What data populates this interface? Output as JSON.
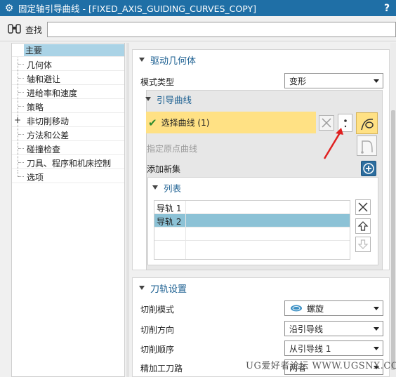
{
  "window": {
    "title": "固定轴引导曲线 - [FIXED_AXIS_GUIDING_CURVES_COPY]",
    "help_label": "?"
  },
  "search": {
    "label": "查找",
    "value": ""
  },
  "tree": {
    "items": [
      {
        "label": "主要",
        "selected": true
      },
      {
        "label": "几何体"
      },
      {
        "label": "轴和避让"
      },
      {
        "label": "进给率和速度"
      },
      {
        "label": "策略"
      },
      {
        "label": "非切削移动",
        "expandable": true,
        "expander": "+"
      },
      {
        "label": "方法和公差"
      },
      {
        "label": "碰撞检查"
      },
      {
        "label": "刀具、程序和机床控制"
      },
      {
        "label": "选项"
      }
    ]
  },
  "drive": {
    "section_title": "驱动几何体",
    "mode_label": "模式类型",
    "mode_value": "变形",
    "guide_group_title": "引导曲线",
    "select_curve_label": "选择曲线 (1)",
    "origin_curve_label": "指定原点曲线",
    "add_set_label": "添加新集",
    "list_title": "列表",
    "list_rows": [
      {
        "name": "导轨  1",
        "selected": false
      },
      {
        "name": "导轨  2",
        "selected": true
      }
    ]
  },
  "toolpath": {
    "section_title": "刀轨设置",
    "cut_mode_label": "切削模式",
    "cut_mode_value": "螺旋",
    "cut_direction_label": "切削方向",
    "cut_direction_value": "沿引导线",
    "cut_order_label": "切削顺序",
    "cut_order_value": "从引导线 1",
    "finish_label": "精加工刀路",
    "finish_value": "两者"
  },
  "watermark": "UG爱好者论坛 WWW.UGSNX.COM",
  "colors": {
    "titlebar": "#1f6fa6",
    "section_title": "#1b5f91",
    "selection_highlight": "#ffe184",
    "tree_selected": "#aad3e6",
    "list_selected": "#8cc2d6",
    "annotation_arrow": "#e02020"
  }
}
